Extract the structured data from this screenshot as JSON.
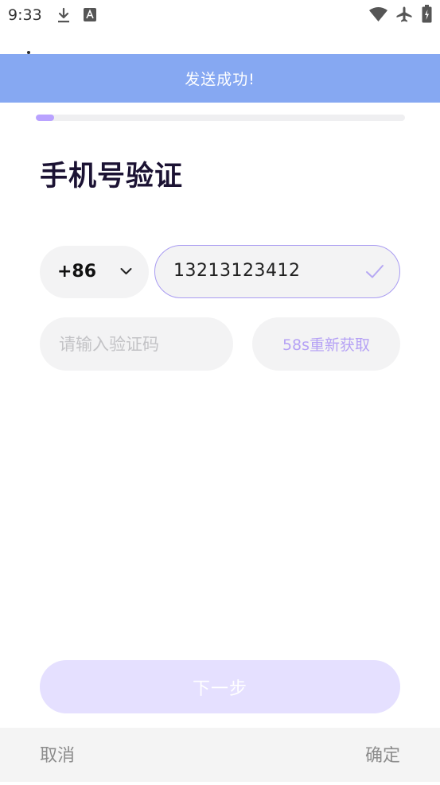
{
  "status_bar": {
    "time": "9:33",
    "icons": [
      "download-icon",
      "keyboard-a-icon",
      "wifi-icon",
      "airplane-mode-icon",
      "battery-icon"
    ]
  },
  "toast": {
    "message": "发送成功!"
  },
  "progress": {
    "fraction": 0.05,
    "color": "#b9a2ff"
  },
  "page": {
    "title": "手机号验证"
  },
  "phone": {
    "country_code": "+86",
    "number": "13213123412",
    "valid_icon": "check-icon"
  },
  "code": {
    "placeholder": "请输入验证码",
    "resend_label": "58s重新获取"
  },
  "actions": {
    "next_label": "下一步",
    "cancel_label": "取消",
    "confirm_label": "确定"
  },
  "colors": {
    "toast": "#86a8f2",
    "accent": "#a99cf2",
    "next_disabled": "#e5e0ff"
  }
}
